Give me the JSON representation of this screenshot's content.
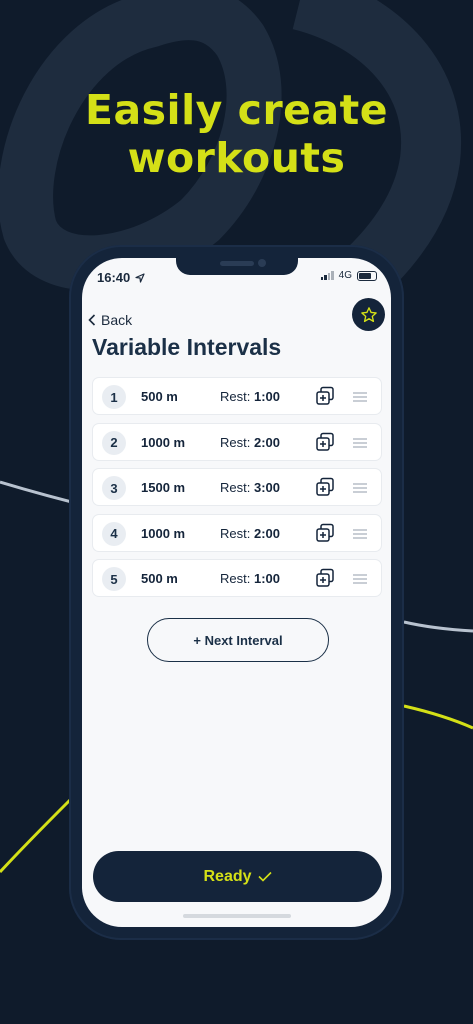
{
  "headline": {
    "line1": "Easily create",
    "line2": "workouts"
  },
  "status_bar": {
    "time": "16:40",
    "network": "4G"
  },
  "nav": {
    "back_label": "Back"
  },
  "page": {
    "title": "Variable Intervals"
  },
  "intervals": [
    {
      "index": "1",
      "distance": "500 m",
      "rest_label": "Rest:",
      "rest": "1:00"
    },
    {
      "index": "2",
      "distance": "1000 m",
      "rest_label": "Rest:",
      "rest": "2:00"
    },
    {
      "index": "3",
      "distance": "1500 m",
      "rest_label": "Rest:",
      "rest": "3:00"
    },
    {
      "index": "4",
      "distance": "1000 m",
      "rest_label": "Rest:",
      "rest": "2:00"
    },
    {
      "index": "5",
      "distance": "500 m",
      "rest_label": "Rest:",
      "rest": "1:00"
    }
  ],
  "actions": {
    "next_interval_label": "+ Next Interval",
    "ready_label": "Ready"
  },
  "icons": [
    "location-arrow-icon",
    "signal-icon",
    "battery-icon",
    "chevron-left-icon",
    "star-icon",
    "duplicate-icon",
    "drag-handle-icon",
    "checkmark-icon"
  ],
  "colors": {
    "background": "#0f1b2b",
    "accent": "#d4e017",
    "navy": "#14243a",
    "screen": "#f7f8fa"
  }
}
